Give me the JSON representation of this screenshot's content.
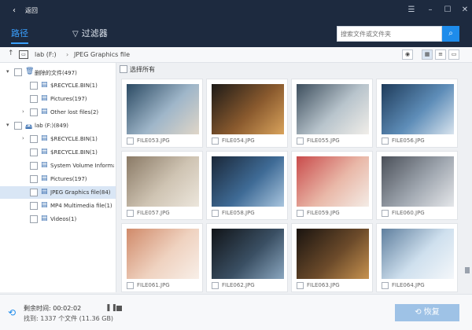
{
  "titlebar": {
    "back_icon": "back-arrow-icon",
    "title": "返回",
    "controls": [
      "menu-icon",
      "minimize-icon",
      "maximize-icon",
      "close-icon"
    ]
  },
  "nav": {
    "path_tab": "路径",
    "filter_label": "过滤器",
    "search_placeholder": "搜索文件或文件夹"
  },
  "breadcrumb": {
    "drive": "lab (F:)",
    "folder": "JPEG Graphics file"
  },
  "sidebar": {
    "items": [
      {
        "label": "删除的文件(497)",
        "indent": 0,
        "arrow": "▾",
        "icon": "🗑"
      },
      {
        "label": "$RECYCLE.BIN(1)",
        "indent": 1,
        "arrow": "",
        "icon": "▤"
      },
      {
        "label": "Pictures(197)",
        "indent": 1,
        "arrow": "",
        "icon": "▤"
      },
      {
        "label": "Other lost files(2)",
        "indent": 1,
        "arrow": "›",
        "icon": "▤"
      },
      {
        "label": "lab (F:)(849)",
        "indent": 0,
        "arrow": "▾",
        "icon": "🖴"
      },
      {
        "label": "$RECYCLE.BIN(1)",
        "indent": 1,
        "arrow": "›",
        "icon": "▤"
      },
      {
        "label": "$RECYCLE.BIN(1)",
        "indent": 1,
        "arrow": "",
        "icon": "▤"
      },
      {
        "label": "System Volume Informati",
        "indent": 1,
        "arrow": "",
        "icon": "▤"
      },
      {
        "label": "Pictures(197)",
        "indent": 1,
        "arrow": "",
        "icon": "▤"
      },
      {
        "label": "JPEG Graphics file(84)",
        "indent": 1,
        "arrow": "",
        "icon": "▤",
        "selected": true
      },
      {
        "label": "MP4 Multimedia file(1)",
        "indent": 1,
        "arrow": "",
        "icon": "▤"
      },
      {
        "label": "Videos(1)",
        "indent": 1,
        "arrow": "",
        "icon": "▤"
      }
    ]
  },
  "main": {
    "select_all": "选择所有",
    "thumbnails": [
      {
        "name": "FILE053.JPG",
        "colors": [
          "#2b4a63",
          "#9fb6c9",
          "#e0d6c8"
        ]
      },
      {
        "name": "FILE054.JPG",
        "colors": [
          "#1d1a17",
          "#8a5a2e",
          "#d9a35c"
        ]
      },
      {
        "name": "FILE055.JPG",
        "colors": [
          "#3d4e5d",
          "#b8c4cc",
          "#f1eee9"
        ]
      },
      {
        "name": "FILE056.JPG",
        "colors": [
          "#1e3b5a",
          "#5e8db8",
          "#d9e4ee"
        ]
      },
      {
        "name": "FILE057.JPG",
        "colors": [
          "#8a7a66",
          "#cfc4b3",
          "#ece6dc"
        ]
      },
      {
        "name": "FILE058.JPG",
        "colors": [
          "#1a2738",
          "#3f6b96",
          "#a9c5de"
        ]
      },
      {
        "name": "FILE059.JPG",
        "colors": [
          "#c94b4b",
          "#e9b8a8",
          "#f4ece6"
        ]
      },
      {
        "name": "FILE060.JPG",
        "colors": [
          "#4a4f58",
          "#a0a7b0",
          "#e5e7ea"
        ]
      },
      {
        "name": "FILE061.JPG",
        "colors": [
          "#d08a6a",
          "#efd2c0",
          "#f8efe8"
        ]
      },
      {
        "name": "FILE062.JPG",
        "colors": [
          "#111418",
          "#3a4f63",
          "#8aa6bf"
        ]
      },
      {
        "name": "FILE063.JPG",
        "colors": [
          "#1a1410",
          "#6b4a2a",
          "#c7924f"
        ]
      },
      {
        "name": "FILE064.JPG",
        "colors": [
          "#5f7f9e",
          "#cfe0ee",
          "#f4f7fa"
        ]
      }
    ]
  },
  "footer": {
    "scan_icon": "scan-icon",
    "elapsed_label": "剩余时间:",
    "elapsed": "00:02:02",
    "found": "找到: 1337 个文件 (11.36 GB)",
    "recover_label": "恢复"
  },
  "colors": {
    "header_bg": "#1d2a3f",
    "accent": "#1e8ceb",
    "tab_active": "#3aa0ff",
    "recover_disabled": "#9ec2e6"
  }
}
